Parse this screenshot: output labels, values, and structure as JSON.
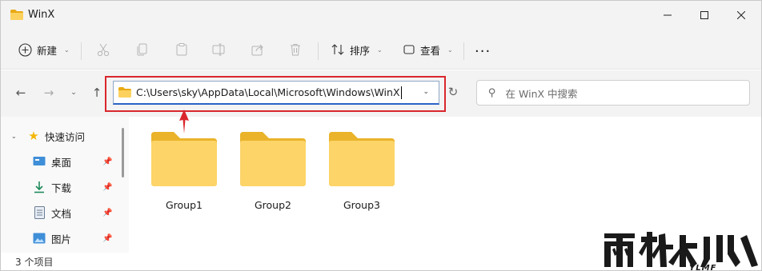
{
  "window": {
    "title": "WinX"
  },
  "toolbar": {
    "new_label": "新建",
    "sort_label": "排序",
    "view_label": "查看",
    "more_label": "···"
  },
  "address": {
    "path": "C:\\Users\\sky\\AppData\\Local\\Microsoft\\Windows\\WinX"
  },
  "search": {
    "placeholder": "在 WinX 中搜索"
  },
  "sidebar": {
    "items": [
      {
        "label": "快速访问",
        "icon": "star-icon"
      },
      {
        "label": "桌面",
        "icon": "desktop-icon"
      },
      {
        "label": "下载",
        "icon": "download-icon"
      },
      {
        "label": "文档",
        "icon": "document-icon"
      },
      {
        "label": "图片",
        "icon": "picture-icon"
      }
    ]
  },
  "files": [
    {
      "name": "Group1"
    },
    {
      "name": "Group2"
    },
    {
      "name": "Group3"
    }
  ],
  "status": {
    "item_count": "3 个项目"
  },
  "colors": {
    "highlight_red": "#d9262c",
    "folder_yellow": "#f7c948",
    "accent_blue": "#2a64c8"
  }
}
